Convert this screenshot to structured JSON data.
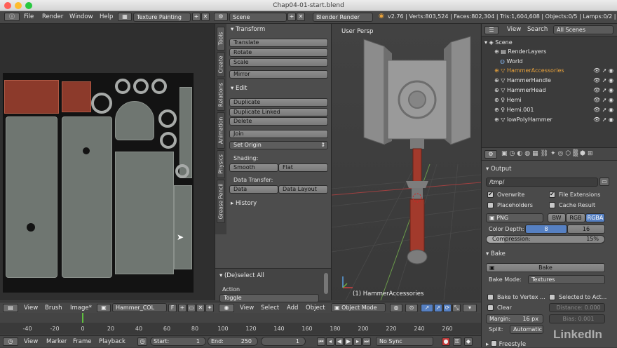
{
  "window_title": "Chap04-01-start.blend",
  "topbar": {
    "menus": [
      "File",
      "Render",
      "Window",
      "Help"
    ],
    "workspace": "Texture Painting",
    "scene": "Scene",
    "render_engine": "Blender Render",
    "stats": "v2.76 | Verts:803,524 | Faces:802,304 | Tris:1,604,608 | Objects:0/5 | Lamps:0/2 | Mem"
  },
  "uv_editor": {
    "header_items": [
      "View",
      "Brush",
      "Image*"
    ],
    "image_name": "Hammer_COL",
    "image_flag": "F"
  },
  "tool_shelf": {
    "tabs": [
      "Tools",
      "Create",
      "Relations",
      "Animation",
      "Physics",
      "Grease Pencil"
    ],
    "transform_header": "Transform",
    "translate": "Translate",
    "rotate": "Rotate",
    "scale": "Scale",
    "mirror": "Mirror",
    "edit_header": "Edit",
    "duplicate": "Duplicate",
    "duplicate_linked": "Duplicate Linked",
    "delete": "Delete",
    "join": "Join",
    "set_origin": "Set Origin",
    "shading_label": "Shading:",
    "smooth": "Smooth",
    "flat": "Flat",
    "data_transfer_label": "Data Transfer:",
    "data": "Data",
    "data_layout": "Data Layout",
    "history_header": "History",
    "operator_header": "(De)select All",
    "action_label": "Action",
    "action_value": "Toggle"
  },
  "viewport": {
    "view_name": "User Persp",
    "object_label": "(1) HammerAccessories",
    "header_items": [
      "View",
      "Select",
      "Add",
      "Object"
    ],
    "mode": "Object Mode"
  },
  "outliner": {
    "header_items": [
      "View",
      "Search"
    ],
    "scope": "All Scenes",
    "items": [
      "Scene",
      "RenderLayers",
      "World",
      "HammerAccessories",
      "HammerHandle",
      "HammerHead",
      "Hemi",
      "Hemi.001",
      "lowPolyHammer"
    ]
  },
  "properties": {
    "output_header": "Output",
    "path": "/tmp/",
    "overwrite": "Overwrite",
    "file_extensions": "File Extensions",
    "placeholders": "Placeholders",
    "cache_result": "Cache Result",
    "format": "PNG",
    "bw": "BW",
    "rgb": "RGB",
    "rgba": "RGBA",
    "color_depth_label": "Color Depth:",
    "depth_8": "8",
    "depth_16": "16",
    "compression_label": "Compression:",
    "compression_value": "15%",
    "compression_fraction": 0.15,
    "bake_header": "Bake",
    "bake_button": "Bake",
    "bake_mode_label": "Bake Mode:",
    "bake_mode": "Textures",
    "bake_to_vertex": "Bake to Vertex ...",
    "selected_to_active": "Selected to Act...",
    "clear": "Clear",
    "distance": "Distance: 0.000",
    "margin": "Margin:",
    "margin_value": "16 px",
    "bias": "Bias: 0.001",
    "split_label": "Split:",
    "split_value": "Automatic",
    "freestyle": "Freestyle"
  },
  "timeline": {
    "ticks": [
      "-40",
      "-20",
      "0",
      "20",
      "40",
      "60",
      "80",
      "100",
      "120",
      "140",
      "160",
      "180",
      "200",
      "220",
      "240",
      "260"
    ],
    "header_items": [
      "View",
      "Marker",
      "Frame",
      "Playback"
    ],
    "start_label": "Start:",
    "start_value": "1",
    "end_label": "End:",
    "end_value": "250",
    "current_frame": "1",
    "sync": "No Sync"
  },
  "watermark": "LinkedIn",
  "colors": {
    "accent": "#5680c2",
    "selected_row": "#e9a23b",
    "background": "#3d3d3d"
  }
}
